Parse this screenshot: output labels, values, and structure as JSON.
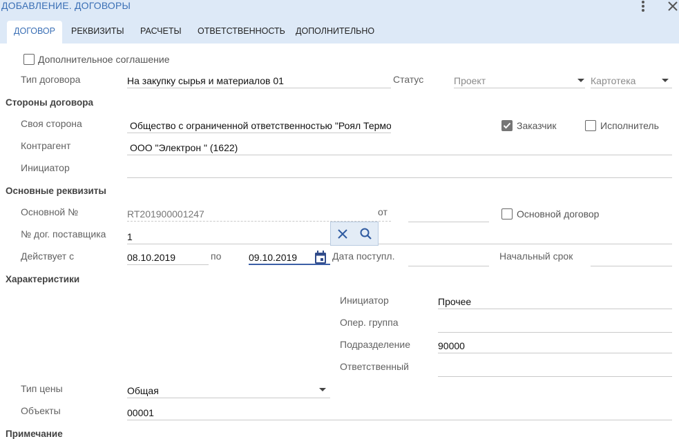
{
  "header": {
    "title": "ДОБАВЛЕНИЕ. ДОГОВОРЫ",
    "menu_icon": "more-vert-icon",
    "close_icon": "close-icon"
  },
  "tabs": [
    {
      "label": "ДОГОВОР",
      "active": true
    },
    {
      "label": "РЕКВИЗИТЫ",
      "active": false
    },
    {
      "label": "РАСЧЕТЫ",
      "active": false
    },
    {
      "label": "ОТВЕТСТВЕННОСТЬ",
      "active": false
    },
    {
      "label": "ДОПОЛНИТЕЛЬНО",
      "active": false
    }
  ],
  "form": {
    "supplementary": {
      "label": "Дополнительное соглашение",
      "checked": false
    },
    "contract_type": {
      "label": "Тип договора",
      "value": "На закупку сырья и материалов 01"
    },
    "status": {
      "label": "Статус",
      "value": "Проект"
    },
    "card_index": {
      "value": "Картотека"
    },
    "parties_section": "Стороны договора",
    "own_side": {
      "label": "Своя сторона",
      "value": "Общество с ограниченной ответственностью \"Роял Термо Рус\""
    },
    "customer": {
      "label": "Заказчик",
      "checked": true
    },
    "executor": {
      "label": "Исполнитель",
      "checked": false
    },
    "counterparty": {
      "label": "Контрагент",
      "value": "ООО \"Электрон \" (1622)"
    },
    "initiator_party": {
      "label": "Инициатор",
      "value": ""
    },
    "main_section": "Основные реквизиты",
    "main_number": {
      "label": "Основной №",
      "value": "RT201900001247"
    },
    "from": {
      "label": "от",
      "value": ""
    },
    "main_contract": {
      "label": "Основной договор",
      "checked": false
    },
    "supplier_number": {
      "label": "№ дог. поставщика",
      "value": "1"
    },
    "valid_from": {
      "label": "Действует с",
      "value": "08.10.2019"
    },
    "valid_to": {
      "label": "по",
      "value": "09.10.2019"
    },
    "receipt_date": {
      "label": "Дата поступл.",
      "value": ""
    },
    "initial_term": {
      "label": "Начальный срок",
      "value": ""
    },
    "characteristics_section": "Характеристики",
    "initiator": {
      "label": "Инициатор",
      "value": "Прочее"
    },
    "oper_group": {
      "label": "Опер. группа",
      "value": ""
    },
    "department": {
      "label": "Подразделение",
      "value": "90000"
    },
    "responsible": {
      "label": "Ответственный",
      "value": ""
    },
    "price_type": {
      "label": "Тип цены",
      "value": "Общая"
    },
    "objects": {
      "label": "Объекты",
      "value": "00001"
    },
    "note_section": "Примечание"
  },
  "colors": {
    "header_bg": "#dde9f7",
    "accent": "#3a6fb5",
    "focus_line": "#3b5ea6"
  }
}
